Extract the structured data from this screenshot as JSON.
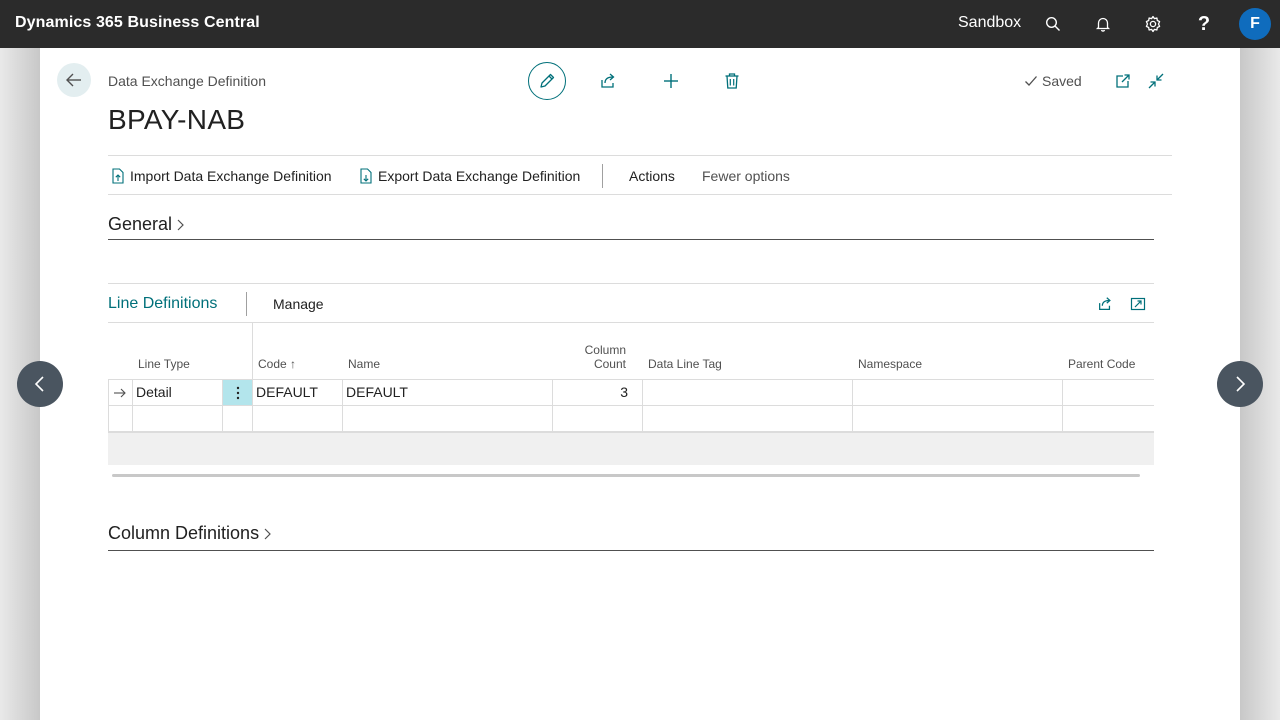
{
  "topbar": {
    "app_title": "Dynamics 365 Business Central",
    "environment": "Sandbox",
    "icons": [
      "search-icon",
      "bell-icon",
      "gear-icon",
      "help-icon"
    ],
    "avatar_initial": "F"
  },
  "header": {
    "caption": "Data Exchange Definition",
    "title": "BPAY-NAB",
    "saved_label": "Saved"
  },
  "actions": {
    "import_label": "Import Data Exchange Definition",
    "export_label": "Export Data Exchange Definition",
    "actions_label": "Actions",
    "fewer_options_label": "Fewer options"
  },
  "sections": {
    "general": "General",
    "column_definitions": "Column Definitions"
  },
  "line_definitions": {
    "title": "Line Definitions",
    "manage_label": "Manage",
    "columns": {
      "line_type": "Line Type",
      "code": "Code",
      "code_sort": "↑",
      "name": "Name",
      "column_count_1": "Column",
      "column_count_2": "Count",
      "data_line_tag": "Data Line Tag",
      "namespace": "Namespace",
      "parent_code": "Parent Code"
    },
    "rows": [
      {
        "line_type": "Detail",
        "code": "DEFAULT",
        "name": "DEFAULT",
        "column_count": "3",
        "data_line_tag": "",
        "namespace": "",
        "parent_code": ""
      }
    ]
  },
  "colors": {
    "accent": "#00707a",
    "topbar": "#2b2b2b",
    "avatar": "#0f6cbd"
  }
}
